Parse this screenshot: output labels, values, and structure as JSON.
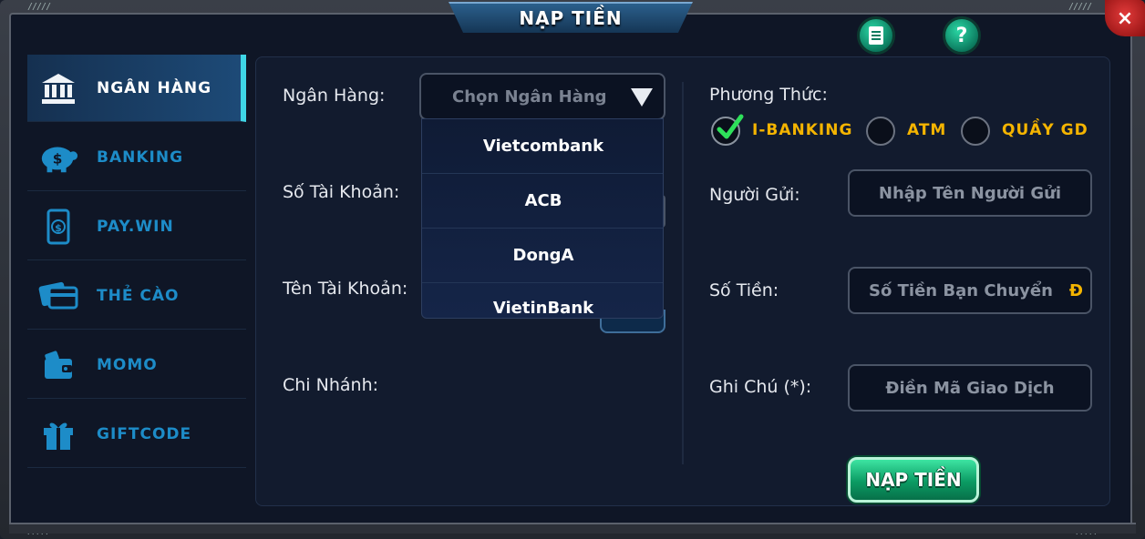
{
  "title": "NẠP TIỀN",
  "top_icons": {
    "notes": "notes-icon",
    "help": "?"
  },
  "close": "×",
  "sidebar": {
    "items": [
      {
        "label": "NGÂN HÀNG",
        "icon": "bank-icon",
        "active": true
      },
      {
        "label": "BANKING",
        "icon": "piggy-bank-icon",
        "active": false
      },
      {
        "label": "PAY.WIN",
        "icon": "mobile-pay-icon",
        "active": false
      },
      {
        "label": "THẺ CÀO",
        "icon": "card-icon",
        "active": false
      },
      {
        "label": "MOMO",
        "icon": "wallet-icon",
        "active": false
      },
      {
        "label": "GIFTCODE",
        "icon": "gift-icon",
        "active": false
      }
    ]
  },
  "left_form": {
    "bank_label": "Ngân Hàng:",
    "bank_select_placeholder": "Chọn Ngân Hàng",
    "account_number_label": "Số Tài Khoản:",
    "account_name_label": "Tên Tài Khoản:",
    "branch_label": "Chi Nhánh:",
    "dropdown_options": [
      "Vietcombank",
      "ACB",
      "DongA",
      "VietinBank"
    ]
  },
  "right_form": {
    "method_label": "Phương Thức:",
    "methods": [
      {
        "label": "I-BANKING",
        "checked": true
      },
      {
        "label": "ATM",
        "checked": false
      },
      {
        "label": "QUẦY GD",
        "checked": false
      }
    ],
    "sender_label": "Người Gửi:",
    "sender_placeholder": "Nhập Tên Người Gửi",
    "amount_label": "Số Tiền:",
    "amount_placeholder": "Số Tiền Bạn Chuyển",
    "currency_symbol": "Đ",
    "note_label": "Ghi Chú (*):",
    "note_placeholder": "Điền Mã Giao Dịch"
  },
  "submit_label": "NẠP TIỀN",
  "colors": {
    "accent_cyan": "#3fd6e6",
    "sidebar_text": "#1d8cc8",
    "method_text": "#f4b400",
    "submit_green": "#0b9b63"
  }
}
